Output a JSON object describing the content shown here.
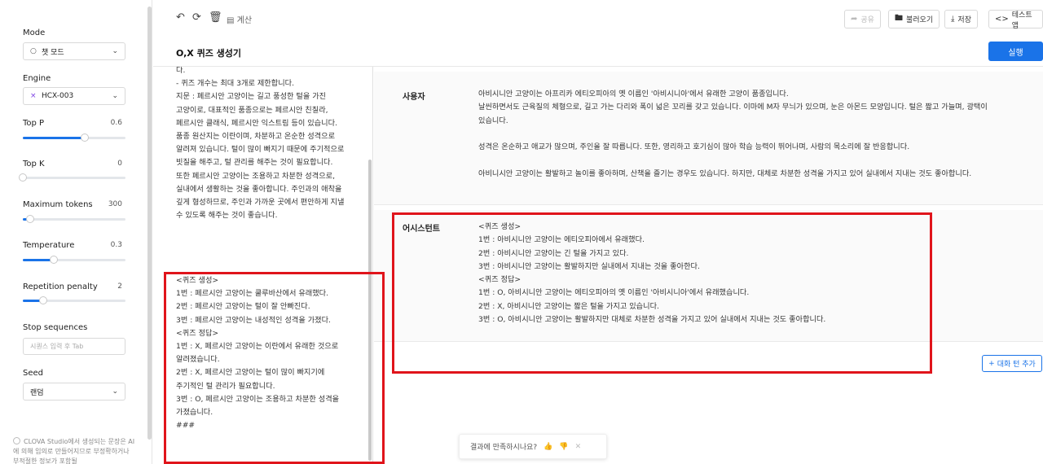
{
  "sidebar": {
    "mode": {
      "label": "Mode",
      "value": "챗 모드",
      "icon": "chat-bubble-icon"
    },
    "engine": {
      "label": "Engine",
      "value": "HCX-003",
      "icon": "x-mark-icon"
    },
    "top_p": {
      "label": "Top P",
      "value": "0.6",
      "level": 0.6
    },
    "top_k": {
      "label": "Top K",
      "value": "0",
      "level": 0.0
    },
    "max_tokens": {
      "label": "Maximum tokens",
      "value": "300",
      "level": 0.07
    },
    "temperature": {
      "label": "Temperature",
      "value": "0.3",
      "level": 0.3
    },
    "repetition_penalty": {
      "label": "Repetition penalty",
      "value": "2",
      "level": 0.2
    },
    "stop_sequences": {
      "label": "Stop sequences",
      "placeholder": "시퀀스 입력 후 Tab"
    },
    "seed": {
      "label": "Seed",
      "value": "랜덤"
    },
    "footer": "CLOVA Studio에서 생성되는 문장은 AI에 의해 임의로 만들어지므로 부정확하거나 부적절한 정보가 포함될"
  },
  "toolbar": {
    "undo_icon": "undo-icon",
    "refresh_icon": "refresh-icon",
    "delete_icon": "trash-icon",
    "calc_label": "계산",
    "share_label": "공유",
    "load_label": "불러오기",
    "save_label": "저장",
    "testapp_label": "테스트 앱"
  },
  "page": {
    "title": "O,X 퀴즈 생성기",
    "run_label": "실행"
  },
  "system_prompt": {
    "top": [
      "다.",
      "- 퀴즈 개수는 최대 3개로 제한합니다.",
      "",
      "지문 : 페르시안 고양이는 길고 풍성한 털을 가진 고양이로, 대표적인 품종으로는 페르시안 친칠라, 페르시안 클래식, 페르시안 익스트림 등이 있습니다. 품종 원산지는 이란이며, 차분하고 온순한 성격으로 알려져 있습니다. 털이 많이 빠지기 때문에 주기적으로 빗질을 해주고, 털 관리를 해주는 것이 필요합니다. 또한 페르시안 고양이는 조용하고 차분한 성격으로, 실내에서 생활하는 것을 좋아합니다. 주인과의 애착을 깊게 형성하므로, 주인과 가까운 곳에서 편안하게 지낼 수 있도록 해주는 것이 좋습니다."
    ],
    "highlighted": [
      "<퀴즈 생성>",
      "1번 : 페르시안 고양이는 쿨루바산에서 유래했다.",
      "2번 : 페르시안 고양이는 털이 잘 안빠진다.",
      "3번 : 페르시안 고양이는 내성적인 성격을 가졌다.",
      "<퀴즈 정답>",
      "1번 : X, 페르시안 고양이는 이란에서 유래한 것으로 알려졌습니다.",
      "2번 : X, 페르시안 고양이는 털이 많이 빠지기에 주기적인 털 관리가 필요합니다.",
      "3번 : O, 페르시안 고양이는 조용하고 차분한 성격을 가졌습니다.",
      "###"
    ]
  },
  "chat": {
    "user": {
      "role": "사용자",
      "text": "아비시니안 고양이는 아프리카 에티오피아의 옛 이름인 '아비시니아'에서 유래한 고양이 품종입니다.\n날씬하면서도 근육질의 체형으로, 길고 가는 다리와 폭이 넓은 꼬리를 갖고 있습니다. 이마에 M자 무늬가 있으며, 눈은 아몬드 모양입니다. 털은 짧고 가늘며, 광택이 있습니다.\n\n성격은 온순하고 애교가 많으며, 주인을 잘 따릅니다. 또한, 영리하고 호기심이 많아 학습 능력이 뛰어나며, 사람의 목소리에 잘 반응합니다.\n\n아비니시안 고양이는 활발하고 놀이를 좋아하며, 산책을 즐기는 경우도 있습니다. 하지만, 대체로 차분한 성격을 가지고 있어 실내에서 지내는 것도 좋아합니다."
    },
    "assistant": {
      "role": "어시스턴트",
      "text": "<퀴즈 생성>\n1번 : 아비시니안 고양이는 에티오피아에서 유래했다.\n2번 : 아비시니안 고양이는 긴 털을 가지고 있다.\n3번 : 아비시니안 고양이는 활발하지만 실내에서 지내는 것을 좋아한다.\n<퀴즈 정답>\n1번 : O, 아비시니안 고양이는 에티오피아의 옛 이름인 '아비시니아'에서 유래했습니다.\n2번 : X, 아비시니안 고양이는 짧은 털을 가지고 있습니다.\n3번 : O, 아비시니안 고양이는 활발하지만 대체로 차분한 성격을 가지고 있어 실내에서 지내는 것도 좋아합니다."
    },
    "add_turn_label": "대화 턴 추가"
  },
  "feedback": {
    "prompt": "결과에 만족하시나요?",
    "thumb_up_icon": "thumbs-up-icon",
    "thumb_down_icon": "thumbs-down-icon",
    "close_icon": "close-icon"
  },
  "colors": {
    "accent": "#1a73e8",
    "highlight": "#e0141b"
  }
}
